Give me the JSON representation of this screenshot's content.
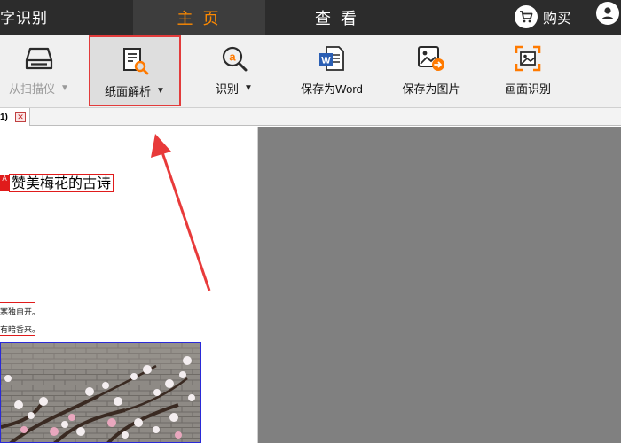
{
  "app": {
    "title_fragment": "字识别"
  },
  "tabs": [
    {
      "label": "主 页",
      "active": true
    },
    {
      "label": "查 看",
      "active": false
    }
  ],
  "header": {
    "buy_label": "购买"
  },
  "toolbar": {
    "scanner_label": "从扫描仪",
    "paper_analysis_label": "纸面解析",
    "recognize_label": "识别",
    "save_word_label": "保存为Word",
    "save_image_label": "保存为图片",
    "screen_recognize_label": "画面识别",
    "dropdown_caret": "▼"
  },
  "document_tab": {
    "label": "1)",
    "close_symbol": "✕"
  },
  "document": {
    "title": "赞美梅花的古诗",
    "title_marker": "A",
    "line_1": "寒独自开。",
    "line_2": "有暗香来。"
  },
  "colors": {
    "topbar": "#2c2c2c",
    "active_tab_text": "#ff8a00",
    "highlight_border": "#e23b3b",
    "annotation_arrow": "#e83a3a",
    "region_text_border": "#e01b1b",
    "region_image_border": "#2a2ad8",
    "right_pane": "#808080"
  }
}
